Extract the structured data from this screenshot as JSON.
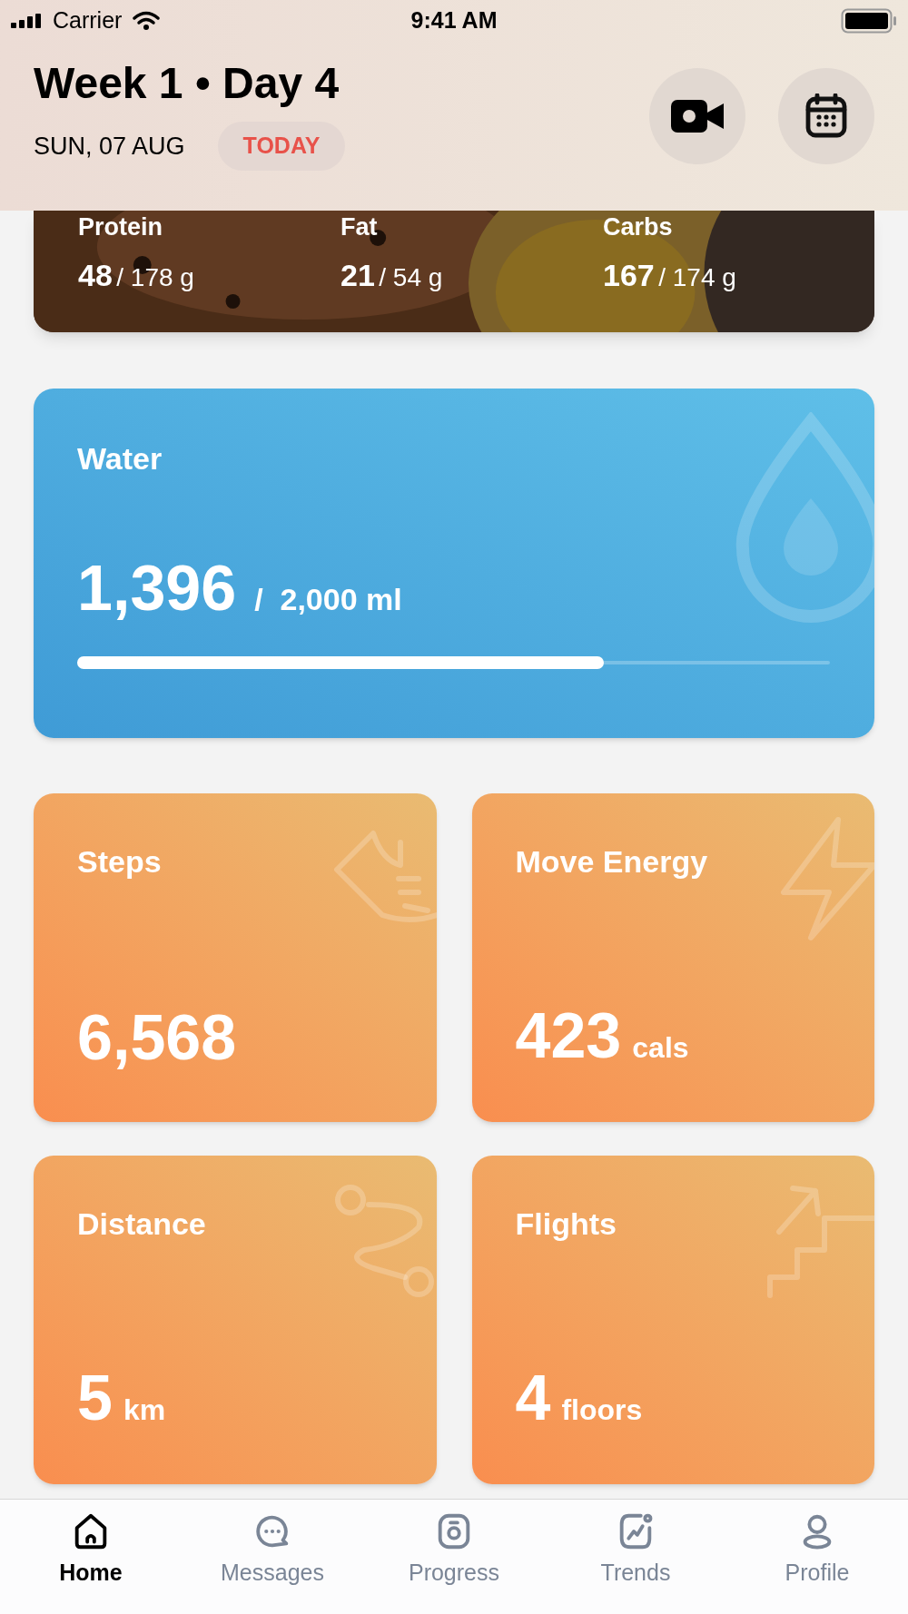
{
  "status_bar": {
    "carrier": "Carrier",
    "time": "9:41 AM"
  },
  "header": {
    "title": "Week 1 • Day 4",
    "date": "SUN, 07 AUG",
    "badge": "TODAY"
  },
  "macros": [
    {
      "label": "Protein",
      "value": "48",
      "goal": "/ 178 g"
    },
    {
      "label": "Fat",
      "value": "21",
      "goal": "/ 54 g"
    },
    {
      "label": "Carbs",
      "value": "167",
      "goal": "/ 174 g"
    }
  ],
  "water": {
    "label": "Water",
    "value": "1,396",
    "goal": "/  2,000 ml",
    "level": 0.7
  },
  "tiles": [
    {
      "kind": "steps",
      "label": "Steps",
      "value": "6,568"
    },
    {
      "kind": "energy",
      "label": "Move Energy",
      "value": "423",
      "unit": "cals"
    },
    {
      "kind": "distance",
      "label": "Distance",
      "value": "5",
      "unit": "km"
    },
    {
      "kind": "flights",
      "label": "Flights",
      "value": "4",
      "unit": "floors"
    }
  ],
  "tab_bar": [
    {
      "kind": "home",
      "label": "Home",
      "selected": true
    },
    {
      "kind": "messages",
      "label": "Messages",
      "selected": false
    },
    {
      "kind": "progress",
      "label": "Progress",
      "selected": false
    },
    {
      "kind": "trends",
      "label": "Trends",
      "selected": false
    },
    {
      "kind": "profile",
      "label": "Profile",
      "selected": false
    }
  ]
}
